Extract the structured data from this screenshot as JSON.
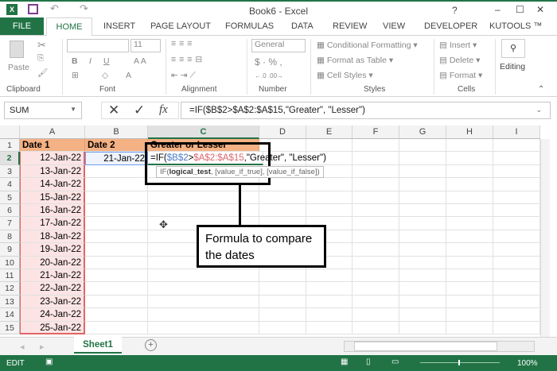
{
  "window": {
    "title": "Book6 - Excel",
    "help": "?",
    "minimize": "–",
    "maximize": "☐",
    "close": "✕"
  },
  "tabs": {
    "file": "FILE",
    "items": [
      "HOME",
      "INSERT",
      "PAGE LAYOUT",
      "FORMULAS",
      "DATA",
      "REVIEW",
      "VIEW",
      "DEVELOPER",
      "KUTOOLS ™"
    ]
  },
  "ribbon": {
    "paste": "Paste",
    "font_size": "11",
    "number_format": "General",
    "conditional_formatting": "Conditional Formatting",
    "format_as_table": "Format as Table",
    "cell_styles": "Cell Styles",
    "insert": "Insert",
    "delete": "Delete",
    "format": "Format",
    "editing": "Editing",
    "groups": [
      "Clipboard",
      "Font",
      "Alignment",
      "Number",
      "Styles",
      "Cells"
    ]
  },
  "formula_bar": {
    "name_box": "SUM",
    "formula": "=IF($B$2>$A$2:$A$15,\"Greater\", \"Lesser\")"
  },
  "columns": [
    "A",
    "B",
    "C",
    "D",
    "E",
    "F",
    "G",
    "H",
    "I"
  ],
  "rows": [
    "1",
    "2",
    "3",
    "4",
    "5",
    "6",
    "7",
    "8",
    "9",
    "10",
    "11",
    "12",
    "13",
    "14",
    "15"
  ],
  "headers": {
    "a": "Date 1",
    "b": "Date 2",
    "c": "Greater or Lesser"
  },
  "date1": [
    "12-Jan-22",
    "13-Jan-22",
    "14-Jan-22",
    "15-Jan-22",
    "16-Jan-22",
    "17-Jan-22",
    "18-Jan-22",
    "19-Jan-22",
    "20-Jan-22",
    "21-Jan-22",
    "22-Jan-22",
    "23-Jan-22",
    "24-Jan-22",
    "25-Jan-22"
  ],
  "date2": "21-Jan-22",
  "edit_formula": {
    "p1": "=IF(",
    "p2": "$B$2",
    ">": ">",
    "p3": "$A$2:$A$15",
    "p4": ",\"Greater\", \"Lesser\")"
  },
  "tooltip": {
    "fn": "IF(",
    "arg1": "logical_test",
    "rest": ", [value_if_true], [value_if_false])"
  },
  "annotation": "Formula to compare the dates",
  "sheet_tab": "Sheet1",
  "status": {
    "mode": "EDIT",
    "zoom": "100%"
  },
  "colors": {
    "excel_green": "#217346",
    "header_orange": "#f4b183",
    "date_pink": "#fce4e4"
  }
}
